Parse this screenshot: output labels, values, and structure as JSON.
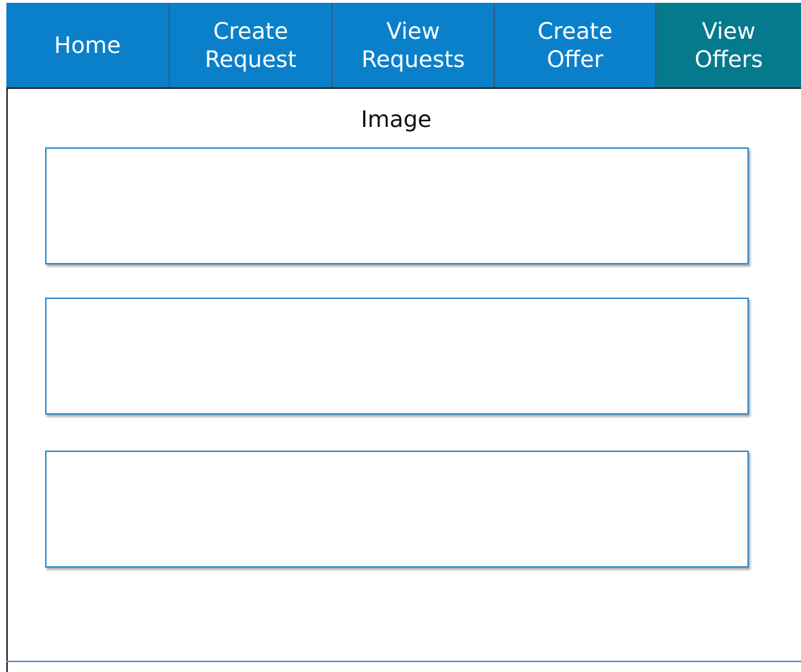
{
  "nav": {
    "tabs": [
      {
        "label": "Home",
        "active": false
      },
      {
        "label": "Create\nRequest",
        "active": false
      },
      {
        "label": "View\nRequests",
        "active": false
      },
      {
        "label": "Create\nOffer",
        "active": false
      },
      {
        "label": "View\nOffers",
        "active": true
      }
    ]
  },
  "main": {
    "image_label": "Image"
  },
  "colors": {
    "tab_bg": "#0a80ca",
    "tab_active_bg": "#057a8d",
    "tab_text": "#ffffff",
    "box_border": "#2f8ad0"
  }
}
